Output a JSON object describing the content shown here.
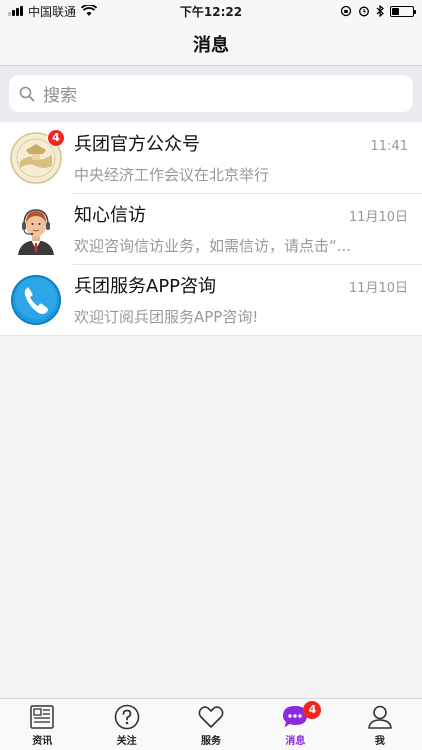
{
  "status_bar": {
    "carrier": "中国联通",
    "time": "下午12:22",
    "icons": [
      "signal-icon",
      "wifi-icon",
      "rotation-lock-icon",
      "alarm-icon",
      "bluetooth-icon",
      "battery-icon"
    ]
  },
  "nav": {
    "title": "消息"
  },
  "search": {
    "placeholder": "搜索",
    "icon": "search-icon"
  },
  "messages": [
    {
      "title": "兵团官方公众号",
      "preview": "中央经济工作会议在北京举行",
      "time": "11:41",
      "badge": "4",
      "avatar": "emblem-avatar"
    },
    {
      "title": "知心信访",
      "preview": "欢迎咨询信访业务，如需信访，请点击“...",
      "time": "11月10日",
      "avatar": "agent-avatar"
    },
    {
      "title": "兵团服务APP咨询",
      "preview": "欢迎订阅兵团服务APP咨询!",
      "time": "11月10日",
      "avatar": "phone-avatar"
    }
  ],
  "tabs": [
    {
      "label": "资讯",
      "icon": "newspaper-icon"
    },
    {
      "label": "关注",
      "icon": "question-icon"
    },
    {
      "label": "服务",
      "icon": "heart-icon"
    },
    {
      "label": "消息",
      "icon": "chat-bubble-icon",
      "badge": "4",
      "active": true
    },
    {
      "label": "我",
      "icon": "user-icon"
    }
  ],
  "colors": {
    "accent": "#8a2be2",
    "badge": "#f4251e",
    "phone_blue": "#1e9be0"
  }
}
